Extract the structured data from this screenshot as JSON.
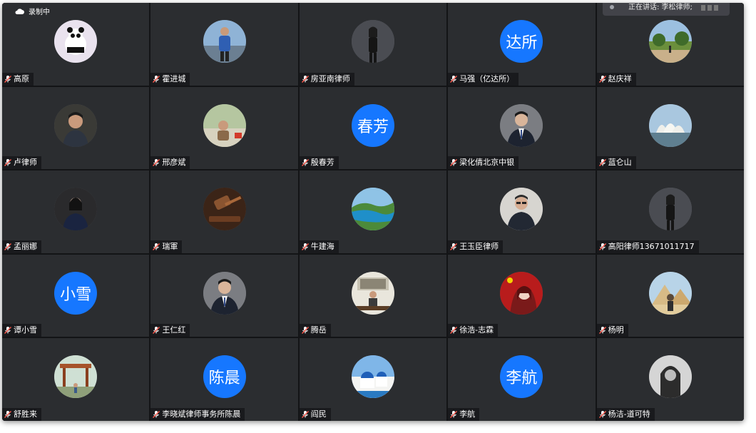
{
  "recording": {
    "icon": "cloud-icon",
    "label": "录制中"
  },
  "speaking_indicator": {
    "label": "正在讲话: 李松律师;"
  },
  "colors": {
    "tile_bg": "#2b2d30",
    "text_avatar_bg": "#1677ff",
    "window_bg": "#131416"
  },
  "participants": [
    {
      "name": "高原",
      "avatar": "panda"
    },
    {
      "name": "霍进城",
      "avatar": "runner"
    },
    {
      "name": "房亚南律师",
      "avatar": "woman-standing"
    },
    {
      "name": "马强（亿达所）",
      "avatar": "text",
      "avatar_text": "达所"
    },
    {
      "name": "赵庆祥",
      "avatar": "park"
    },
    {
      "name": "卢律师",
      "avatar": "man-dark"
    },
    {
      "name": "邢彦斌",
      "avatar": "outdoor-man"
    },
    {
      "name": "殷春芳",
      "avatar": "text",
      "avatar_text": "春芳"
    },
    {
      "name": "梁化倩北京中银",
      "avatar": "man-suit"
    },
    {
      "name": "蓝仑山",
      "avatar": "opera-house"
    },
    {
      "name": "孟丽娜",
      "avatar": "woman-suit"
    },
    {
      "name": "瑞軍",
      "avatar": "gavel"
    },
    {
      "name": "牛建海",
      "avatar": "lake"
    },
    {
      "name": "王玉臣律师",
      "avatar": "man-glasses"
    },
    {
      "name": "高阳律师13671011717",
      "avatar": "woman-standing"
    },
    {
      "name": "谭小雪",
      "avatar": "text",
      "avatar_text": "小雪"
    },
    {
      "name": "王仁红",
      "avatar": "man-suit"
    },
    {
      "name": "腾岳",
      "avatar": "man-desk"
    },
    {
      "name": "徐浩-志霖",
      "avatar": "anime-flag"
    },
    {
      "name": "杨明",
      "avatar": "pyramid"
    },
    {
      "name": "舒胜来",
      "avatar": "garden"
    },
    {
      "name": "李晓斌律师事务所陈晨",
      "avatar": "text",
      "avatar_text": "陈晨"
    },
    {
      "name": "阎民",
      "avatar": "santorini"
    },
    {
      "name": "李航",
      "avatar": "text",
      "avatar_text": "李航"
    },
    {
      "name": "杨洁-道可特",
      "avatar": "bw-portrait"
    }
  ]
}
